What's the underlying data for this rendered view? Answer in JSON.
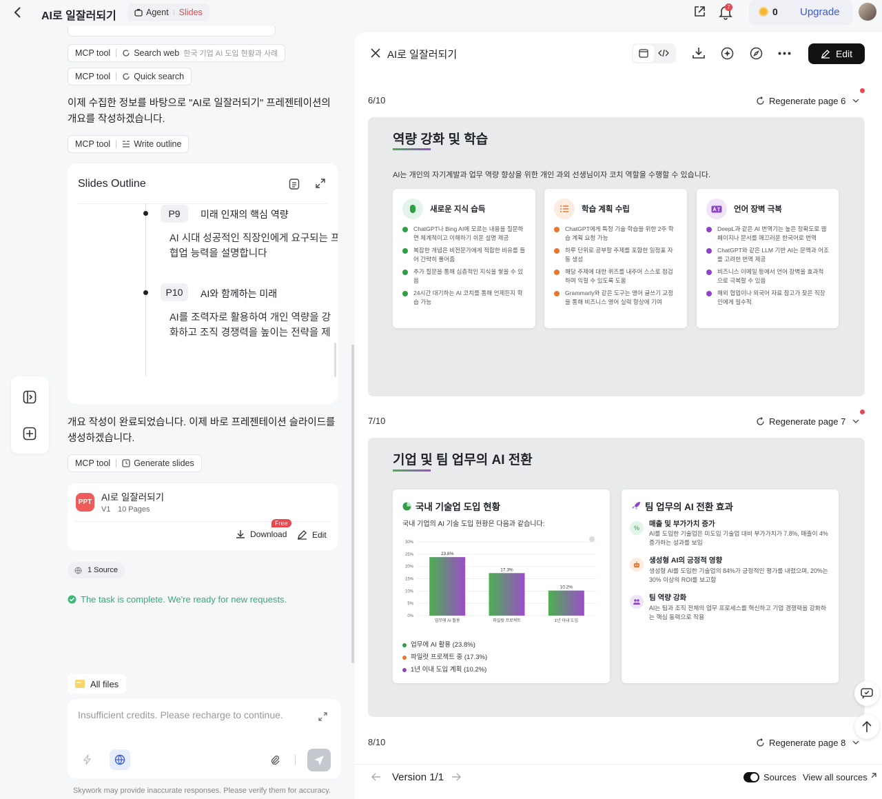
{
  "header": {
    "title": "AI로 일잘러되기",
    "mode_agent": "Agent",
    "mode_slides": "Slides",
    "notif_count": "7",
    "credits": "0",
    "upgrade": "Upgrade"
  },
  "chat": {
    "tool1": {
      "prefix": "MCP tool",
      "name": "Search web",
      "query": "한국 기업 AI 도입 현황과 사례"
    },
    "tool2": {
      "prefix": "MCP tool",
      "name": "Quick search"
    },
    "msg1": "이제 수집한 정보를 바탕으로 \"AI로 일잘러되기\" 프레젠테이션의 개요를 작성하겠습니다.",
    "tool3": {
      "prefix": "MCP tool",
      "name": "Write outline"
    },
    "outline": {
      "title": "Slides Outline",
      "items": [
        {
          "page": "P9",
          "title": "미래 인재의 핵심 역량",
          "desc": "AI 시대 성공적인 직장인에게 요구되는 프롬프트 엔지니어링과 협업 능력을 설명합니다"
        },
        {
          "page": "P10",
          "title": "AI와 함께하는 미래",
          "desc": "AI를 조력자로 활용하여 개인 역량을 강화하고 조직 경쟁력을 높이는 전략을 제시합니다"
        }
      ]
    },
    "msg2": "개요 작성이 완료되었습니다. 이제 바로 프레젠테이션 슬라이드를 생성하겠습니다.",
    "tool4": {
      "prefix": "MCP tool",
      "name": "Generate slides"
    },
    "file": {
      "badge": "PPT",
      "name": "AI로 일잘러되기",
      "version": "V1",
      "pages": "10 Pages",
      "free": "Free",
      "download": "Download",
      "edit": "Edit"
    },
    "source": "1 Source",
    "complete": "The task is complete. We're ready for new requests.",
    "all_files": "All files",
    "input_placeholder": "Insufficient credits. Please recharge to continue.",
    "disclaimer": "Skywork may provide inaccurate responses. Please verify them for accuracy."
  },
  "preview": {
    "title": "AI로 일잘러되기",
    "edit": "Edit",
    "version": "Version 1/1",
    "sources": "Sources",
    "view_all": "View all sources",
    "pages": [
      {
        "num": "6/10",
        "regen": "Regenerate page 6"
      },
      {
        "num": "7/10",
        "regen": "Regenerate page 7"
      },
      {
        "num": "8/10",
        "regen": "Regenerate page 8"
      }
    ]
  },
  "slide6": {
    "title": "역량 강화 및 학습",
    "subtitle": "AI는 개인의 자기계발과 업무 역량 향상을 위한 개인 과외 선생님이자 코치 역할을 수행할 수 있습니다.",
    "cards": [
      {
        "title": "새로운 지식 습득",
        "color": "#2f9e44",
        "icon_bg": "#e3f5e8",
        "items": [
          "ChatGPT나 Bing AI에 모르는 내용을 질문하면 체계적이고 이해하기 쉬운 설명 제공",
          "복잡한 개념은 비전문가에게 적합한 비유를 들어 간략히 풀어줌",
          "추가 질문을 통해 심층적인 지식을 쌓을 수 있음",
          "24시간 대기하는 AI 코치를 통해 언제든지 학습 가능"
        ]
      },
      {
        "title": "학습 계획 수립",
        "color": "#e8772e",
        "icon_bg": "#fdecdf",
        "items": [
          "ChatGPT에게 특정 기술 학습을 위한 2주 학습 계획 요청 가능",
          "하루 단위로 공부할 주제를 포함한 일정표 자동 생성",
          "해당 주제에 대한 퀴즈를 내주어 스스로 점검하며 익힐 수 있도록 도움",
          "Grammarly와 같은 도구는 영어 글쓰기 교정을 통해 비즈니스 영어 실력 향상에 기여"
        ]
      },
      {
        "title": "언어 장벽 극복",
        "color": "#8e44c9",
        "icon_bg": "#efe4f8",
        "items": [
          "DeepL과 같은 AI 번역기는 높은 정확도로 웹페이지나 문서를 매끄러운 한국어로 번역",
          "ChatGPT와 같은 LLM 기반 AI는 문맥과 어조를 고려한 번역 제공",
          "비즈니스 이메일 등에서 언어 장벽을 효과적으로 극복할 수 있음",
          "해외 협업이나 외국어 자료 참고가 잦은 직장인에게 필수적"
        ]
      }
    ]
  },
  "slide7": {
    "title": "기업 및 팀 업무의 AI 전환",
    "left_title": "국내 기술업 도입 현황",
    "left_sub": "국내 기업의 AI 기술 도입 현황은 다음과 같습니다:",
    "right_title": "팀 업무의 AI 전환 효과",
    "effects": [
      {
        "title": "매출 및 부가가치 증가",
        "desc": "AI를 도입한 기술업은 미도입 기술업 대비 부가가치가 7.8%, 매출이 4% 증가하는 성과를 보임",
        "color": "#2f9e44",
        "icon_bg": "#e3f5e8"
      },
      {
        "title": "생성형 AI의 긍정적 영향",
        "desc": "생성형 AI를 도입한 기술업의 84%가 긍정적인 평가를 내렸으며, 20%는 30% 이상의 ROI를 보고함",
        "color": "#e8772e",
        "icon_bg": "#fdecdf"
      },
      {
        "title": "팀 역량 강화",
        "desc": "AI는 팀과 조직 전체의 업무 프로세스를 혁신하고 기업 경쟁력을 강화하는 핵심 동력으로 작용",
        "color": "#8e44c9",
        "icon_bg": "#efe4f8"
      }
    ]
  },
  "chart_data": {
    "type": "bar",
    "categories": [
      "업무에 AI 활용",
      "파일럿 프로젝트",
      "1년 이내 도입"
    ],
    "values": [
      23.8,
      17.3,
      10.2
    ],
    "value_labels": [
      "23.8%",
      "17.3%",
      "10.2%"
    ],
    "ylim": [
      0,
      30
    ],
    "yticks": [
      "0%",
      "5%",
      "10%",
      "15%",
      "20%",
      "25%",
      "30%"
    ],
    "legend": [
      "업무에 AI 활용 (23.8%)",
      "파일럿 프로젝트 중 (17.3%)",
      "1년 이내 도입 계획 (10.2%)"
    ],
    "legend_colors": [
      "#2f9e44",
      "#e8772e",
      "#8e44c9"
    ],
    "legend_position": "bottom",
    "bar_gradient": [
      "#4caf50",
      "#9b4dca"
    ]
  }
}
